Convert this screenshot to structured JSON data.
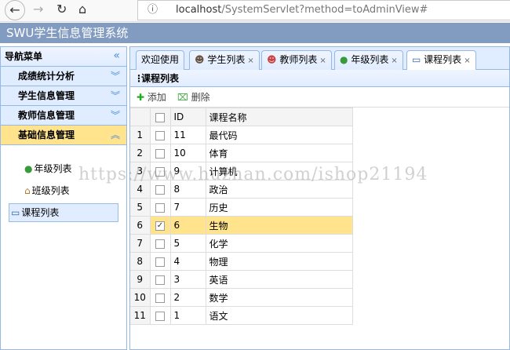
{
  "browser": {
    "url_host": "localhost",
    "url_path": "/SystemServlet?method=toAdminView#"
  },
  "app_title": "SWU学生信息管理系统",
  "sidebar": {
    "title": "导航菜单",
    "sections": [
      {
        "label": "成绩统计分析"
      },
      {
        "label": "学生信息管理"
      },
      {
        "label": "教师信息管理"
      },
      {
        "label": "基础信息管理"
      }
    ],
    "items": [
      {
        "label": "年级列表"
      },
      {
        "label": "班级列表"
      },
      {
        "label": "课程列表"
      }
    ]
  },
  "tabs": [
    {
      "label": "欢迎使用"
    },
    {
      "label": "学生列表"
    },
    {
      "label": "教师列表"
    },
    {
      "label": "年级列表"
    },
    {
      "label": "课程列表"
    }
  ],
  "panel": {
    "title": "课程列表",
    "add": "添加",
    "delete": "删除"
  },
  "table": {
    "headers": [
      "ID",
      "课程名称"
    ],
    "rows": [
      {
        "n": "1",
        "id": "11",
        "name": "最代码",
        "checked": false
      },
      {
        "n": "2",
        "id": "10",
        "name": "体育",
        "checked": false
      },
      {
        "n": "3",
        "id": "9",
        "name": "计算机",
        "checked": false
      },
      {
        "n": "4",
        "id": "8",
        "name": "政治",
        "checked": false
      },
      {
        "n": "5",
        "id": "7",
        "name": "历史",
        "checked": false
      },
      {
        "n": "6",
        "id": "6",
        "name": "生物",
        "checked": true
      },
      {
        "n": "7",
        "id": "5",
        "name": "化学",
        "checked": false
      },
      {
        "n": "8",
        "id": "4",
        "name": "物理",
        "checked": false
      },
      {
        "n": "9",
        "id": "3",
        "name": "英语",
        "checked": false
      },
      {
        "n": "10",
        "id": "2",
        "name": "数学",
        "checked": false
      },
      {
        "n": "11",
        "id": "1",
        "name": "语文",
        "checked": false
      }
    ]
  },
  "watermark": "https://www.huzhan.com/ishop21194"
}
